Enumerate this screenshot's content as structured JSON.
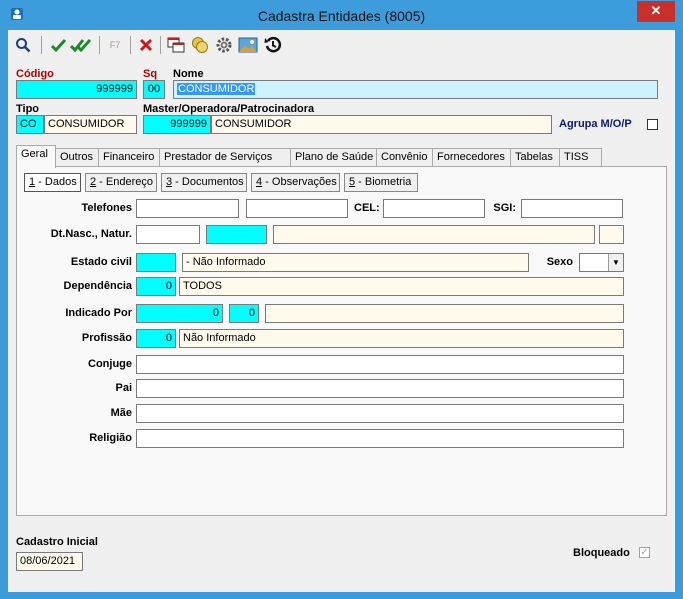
{
  "window": {
    "title": "Cadastra Entidades (8005)",
    "close_label": "✕"
  },
  "toolbar": {
    "f7_label": "F7"
  },
  "header": {
    "codigo_label": "Código",
    "codigo_value": "999999",
    "sq_label": "Sq",
    "sq_value": "00",
    "nome_label": "Nome",
    "nome_value": "CONSUMIDOR",
    "tipo_label": "Tipo",
    "tipo_code": "CO",
    "tipo_desc": "CONSUMIDOR",
    "master_label": "Master/Operadora/Patrocinadora",
    "master_code": "999999",
    "master_desc": "CONSUMIDOR",
    "agrupa_label": "Agrupa M/O/P"
  },
  "tabs": [
    "Geral",
    "Outros",
    "Financeiro",
    "Prestador de Serviços",
    "Plano de Saúde",
    "Convênio",
    "Fornecedores",
    "Tabelas",
    "TISS"
  ],
  "subtabs": [
    {
      "num": "1",
      "label": " - Dados"
    },
    {
      "num": "2",
      "label": " - Endereço"
    },
    {
      "num": "3",
      "label": " - Documentos"
    },
    {
      "num": "4",
      "label": " - Observações"
    },
    {
      "num": "5",
      "label": " - Biometria"
    }
  ],
  "form": {
    "telefones_label": "Telefones",
    "cel_label": "CEL:",
    "sgi_label": "SGI:",
    "dtnasc_label": "Dt.Nasc., Natur.",
    "estado_civil_label": "Estado civil",
    "estado_civil_value": "- Não Informado",
    "sexo_label": "Sexo",
    "dependencia_label": "Dependência",
    "dependencia_code": "0",
    "dependencia_value": "TODOS",
    "indicado_label": "Indicado Por",
    "indicado_code": "0",
    "indicado_seq": "0",
    "profissao_label": "Profissão",
    "profissao_code": "0",
    "profissao_value": "Não Informado",
    "conjuge_label": "Conjuge",
    "pai_label": "Pai",
    "mae_label": "Mãe",
    "religiao_label": "Religião"
  },
  "footer": {
    "cadastro_label": "Cadastro Inicial",
    "cadastro_value": "08/06/2021",
    "bloqueado_label": "Bloqueado",
    "bloqueado_checked": true
  }
}
